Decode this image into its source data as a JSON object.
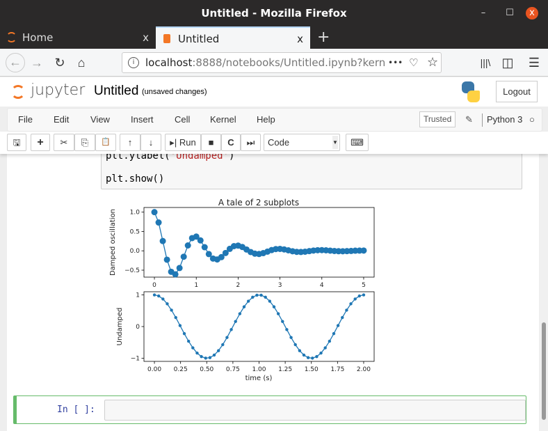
{
  "window": {
    "title": "Untitled - Mozilla Firefox",
    "minimize": "–",
    "maximize": "☐",
    "close": "x"
  },
  "tabs": [
    {
      "label": "Home",
      "close": "x"
    },
    {
      "label": "Untitled",
      "close": "x"
    }
  ],
  "new_tab": "+",
  "nav": {
    "back": "←",
    "forward": "→",
    "reload": "↻",
    "home": "⌂",
    "url_host": "localhost",
    "url_rest": ":8888/notebooks/Untitled.ipynb?kern",
    "more": "•••",
    "pocket": "♡",
    "star": "☆",
    "library": "|||\\",
    "sidebar": "◫",
    "menu": "☰"
  },
  "jupyter": {
    "logo_text": "jupyter",
    "notebook_name": "Untitled",
    "save_status": "(unsaved changes)",
    "logout": "Logout"
  },
  "menubar": {
    "items": [
      "File",
      "Edit",
      "View",
      "Insert",
      "Cell",
      "Kernel",
      "Help"
    ],
    "trusted": "Trusted",
    "kernel": "Python 3",
    "edit_icon": "✎",
    "kernel_status": "○"
  },
  "toolbar": {
    "save": "🖫",
    "add": "+",
    "cut": "✂",
    "copy": "⎘",
    "paste": "📋",
    "up": "↑",
    "down": "↓",
    "run": "Run",
    "stop": "■",
    "restart": "C",
    "fast_forward": "⏭",
    "cell_type": "Code",
    "keyboard": "⌨"
  },
  "cell": {
    "line1_a": "plt.ylabel(",
    "line1_b": "'Undamped'",
    "line1_c": ")",
    "line2": "plt.show()"
  },
  "new_cell": {
    "prompt": "In [ ]:"
  },
  "colors": {
    "series": "#1f77b4",
    "accent_orange": "#f37726",
    "cell_selected": "#66bb6a",
    "string": "#ba2121",
    "prompt": "#303f9f"
  },
  "chart_data": [
    {
      "type": "line",
      "title": "A tale of 2 subplots",
      "xlabel": "",
      "ylabel": "Damped oscillation",
      "marker": "o",
      "xlim": [
        -0.25,
        5.25
      ],
      "ylim": [
        -0.68,
        1.12
      ],
      "xticks": [
        "0",
        "1",
        "2",
        "3",
        "4",
        "5"
      ],
      "yticks": [
        "−0.5",
        "0.0",
        "0.5",
        "1.0"
      ],
      "x": [
        0,
        0.1,
        0.2,
        0.3,
        0.4,
        0.5,
        0.6,
        0.7,
        0.8,
        0.9,
        1.0,
        1.1,
        1.2,
        1.3,
        1.4,
        1.5,
        1.6,
        1.7,
        1.8,
        1.9,
        2.0,
        2.1,
        2.2,
        2.3,
        2.4,
        2.5,
        2.6,
        2.7,
        2.8,
        2.9,
        3.0,
        3.1,
        3.2,
        3.3,
        3.4,
        3.5,
        3.6,
        3.7,
        3.8,
        3.9,
        4.0,
        4.1,
        4.2,
        4.3,
        4.4,
        4.5,
        4.6,
        4.7,
        4.8,
        4.9,
        5.0
      ],
      "y": [
        1.0,
        0.732,
        0.253,
        -0.229,
        -0.542,
        -0.607,
        -0.444,
        -0.153,
        0.139,
        0.329,
        0.368,
        0.269,
        0.093,
        -0.084,
        -0.2,
        -0.223,
        -0.163,
        -0.056,
        0.051,
        0.121,
        0.135,
        0.099,
        0.034,
        -0.031,
        -0.073,
        -0.082,
        -0.06,
        -0.021,
        0.019,
        0.045,
        0.05,
        0.036,
        0.013,
        -0.011,
        -0.027,
        -0.03,
        -0.022,
        -0.008,
        0.007,
        0.016,
        0.018,
        0.013,
        0.005,
        -0.004,
        -0.01,
        -0.011,
        -0.008,
        -0.003,
        0.003,
        0.006,
        0.007
      ]
    },
    {
      "type": "line",
      "title": "",
      "xlabel": "time (s)",
      "ylabel": "Undamped",
      "marker": ".",
      "xlim": [
        -0.1,
        2.1
      ],
      "ylim": [
        -1.1,
        1.1
      ],
      "xticks": [
        "0.00",
        "0.25",
        "0.50",
        "0.75",
        "1.00",
        "1.25",
        "1.50",
        "1.75",
        "2.00"
      ],
      "yticks": [
        "−1",
        "0",
        "1"
      ],
      "x_range": [
        0,
        2
      ],
      "y": [
        1.0,
        0.967,
        0.871,
        0.718,
        0.518,
        0.285,
        0.032,
        -0.223,
        -0.463,
        -0.673,
        -0.838,
        -0.949,
        -0.998,
        -0.982,
        -0.901,
        -0.762,
        -0.572,
        -0.345,
        -0.096,
        0.16,
        0.405,
        0.624,
        0.802,
        0.927,
        0.992,
        0.992,
        0.927,
        0.802,
        0.624,
        0.405,
        0.16,
        -0.096,
        -0.345,
        -0.572,
        -0.762,
        -0.901,
        -0.982,
        -0.998,
        -0.949,
        -0.838,
        -0.673,
        -0.463,
        -0.223,
        0.032,
        0.285,
        0.518,
        0.718,
        0.871,
        0.967,
        1.0
      ]
    }
  ]
}
